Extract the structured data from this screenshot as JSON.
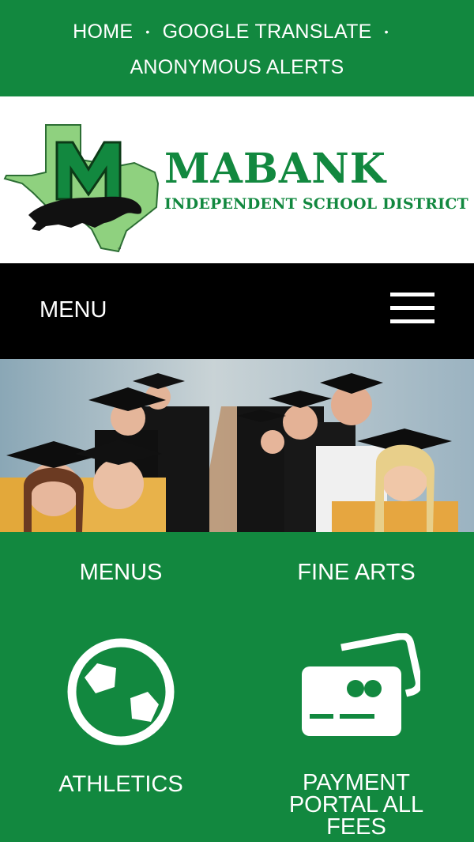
{
  "topnav": {
    "links": [
      {
        "label": "HOME"
      },
      {
        "label": "GOOGLE TRANSLATE"
      },
      {
        "label": "ANONYMOUS ALERTS"
      }
    ]
  },
  "brand": {
    "name": "MABANK",
    "subtitle": "INDEPENDENT SCHOOL DISTRICT",
    "logo_letter": "M"
  },
  "menubar": {
    "label": "MENU"
  },
  "quick_links": [
    {
      "label": "MENUS",
      "icon": "none"
    },
    {
      "label": "FINE ARTS",
      "icon": "none"
    },
    {
      "label": "ATHLETICS",
      "icon": "soccer-ball-icon"
    },
    {
      "label": "PAYMENT PORTAL ALL FEES",
      "icon": "credit-card-icon"
    }
  ],
  "colors": {
    "brand_green": "#12883f",
    "light_green": "#8fd17f",
    "menubar_bg": "#000000"
  }
}
